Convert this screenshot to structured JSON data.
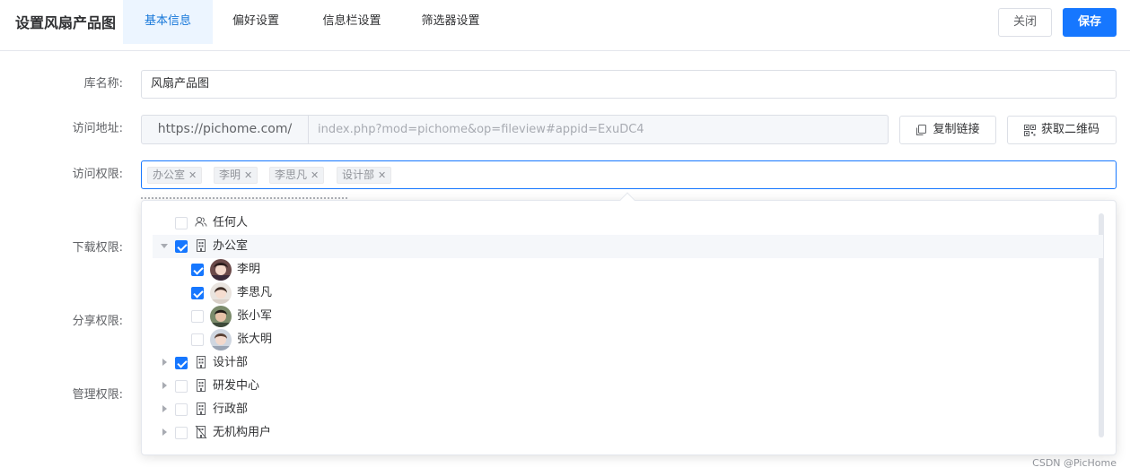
{
  "header": {
    "title": "设置风扇产品图",
    "tabs": [
      {
        "label": "基本信息",
        "active": true
      },
      {
        "label": "偏好设置",
        "active": false
      },
      {
        "label": "信息栏设置",
        "active": false
      },
      {
        "label": "筛选器设置",
        "active": false
      }
    ],
    "close_label": "关闭",
    "save_label": "保存"
  },
  "form": {
    "name_label": "库名称:",
    "name_value": "风扇产品图",
    "url_label": "访问地址:",
    "url_prefix": "https://pichome.com/",
    "url_value": "index.php?mod=pichome&op=fileview#appid=ExuDC4",
    "copy_label": "复制链接",
    "qr_label": "获取二维码",
    "access_label": "访问权限:",
    "selected_tags": [
      "办公室",
      "李明",
      "李思凡",
      "设计部"
    ],
    "download_label": "下载权限:",
    "share_label": "分享权限:",
    "manage_label": "管理权限:"
  },
  "tree": [
    {
      "label": "任何人",
      "icon": "users-icon",
      "checked": false
    },
    {
      "label": "办公室",
      "icon": "building-icon",
      "checked": true,
      "expanded": true
    },
    {
      "label": "李明",
      "icon": "avatar",
      "checked": true
    },
    {
      "label": "李思凡",
      "icon": "avatar",
      "checked": true
    },
    {
      "label": "张小军",
      "icon": "avatar",
      "checked": false
    },
    {
      "label": "张大明",
      "icon": "avatar",
      "checked": false
    },
    {
      "label": "设计部",
      "icon": "building-icon",
      "checked": true,
      "expanded": false
    },
    {
      "label": "研发中心",
      "icon": "building-icon",
      "checked": false,
      "expanded": false
    },
    {
      "label": "行政部",
      "icon": "building-icon",
      "checked": false,
      "expanded": false
    },
    {
      "label": "无机构用户",
      "icon": "no-org-icon",
      "checked": false,
      "expanded": false
    }
  ],
  "colors": {
    "primary": "#1677ff",
    "active_tab_bg": "#ecf5ff"
  },
  "watermark": "CSDN @PicHome"
}
